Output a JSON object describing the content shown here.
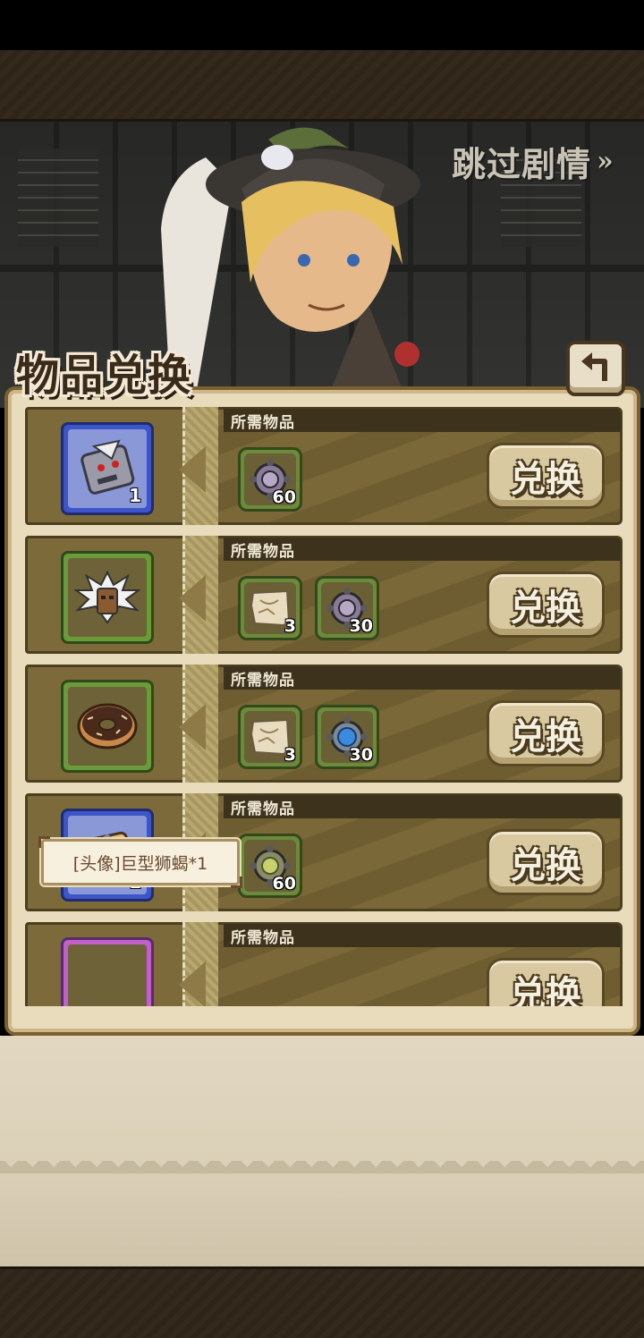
{
  "header": {
    "skip_label": "跳过剧情",
    "skip_chevron": "»",
    "title": "物品兑换",
    "back_icon": "back-arrow-icon"
  },
  "rows": [
    {
      "section_label": "所需物品",
      "reward": {
        "icon": "scarecrow-mask-icon",
        "count": "1",
        "rarity": "blue"
      },
      "costs": [],
      "button_label": "兑换"
    },
    {
      "section_label": "所需物品",
      "reward": {
        "icon": "robot-avatar-icon",
        "count": "1",
        "rarity": "blue"
      },
      "costs": [
        {
          "icon": "purple-turtle-token-icon",
          "count": "60"
        }
      ],
      "button_label": "兑换"
    },
    {
      "section_label": "所需物品",
      "reward": {
        "icon": "spiky-hair-mask-icon",
        "count": "",
        "rarity": "green"
      },
      "costs": [
        {
          "icon": "treasure-map-icon",
          "count": "3"
        },
        {
          "icon": "purple-turtle-token-icon",
          "count": "30"
        }
      ],
      "button_label": "兑换"
    },
    {
      "section_label": "所需物品",
      "reward": {
        "icon": "chocolate-donut-icon",
        "count": "",
        "rarity": "green"
      },
      "costs": [
        {
          "icon": "treasure-map-icon",
          "count": "3"
        },
        {
          "icon": "blue-turtle-token-icon",
          "count": "30"
        }
      ],
      "button_label": "兑换"
    },
    {
      "section_label": "所需物品",
      "reward": {
        "icon": "lion-scorpion-avatar-icon",
        "count": "1",
        "rarity": "blue"
      },
      "costs": [
        {
          "icon": "green-turtle-token-icon",
          "count": "60"
        }
      ],
      "button_label": "兑换"
    },
    {
      "section_label": "所需物品",
      "reward": {
        "icon": "pink-item-icon",
        "count": "",
        "rarity": "purple"
      },
      "costs": [],
      "button_label": "兑换"
    }
  ],
  "tooltip": {
    "text": "[头像]巨型狮蝎*1"
  },
  "colors": {
    "panel": "#e8dcbd",
    "row_bg": "#7a6838",
    "button": "#d9c9a0"
  }
}
